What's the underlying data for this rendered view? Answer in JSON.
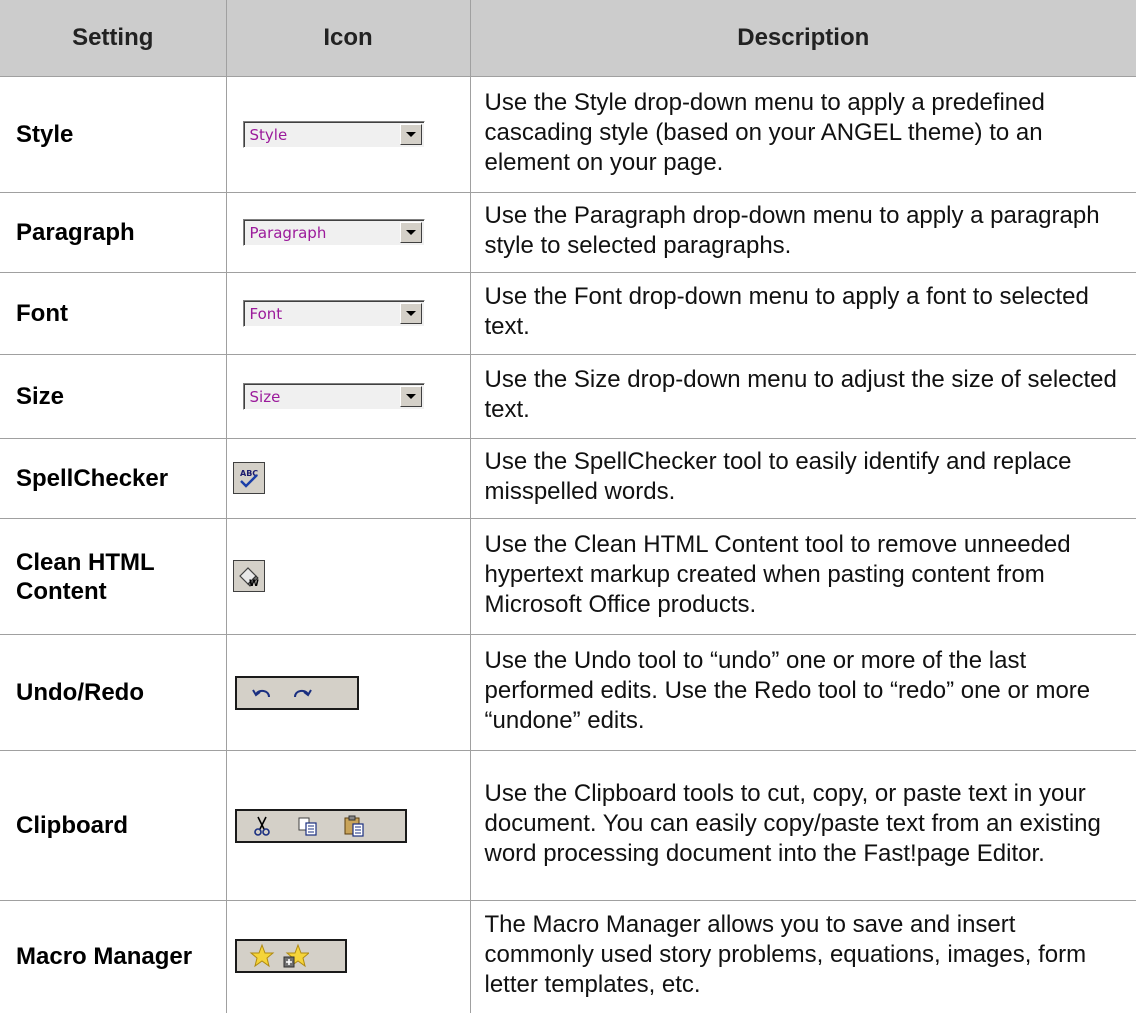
{
  "headers": {
    "setting": "Setting",
    "icon": "Icon",
    "description": "Description"
  },
  "rows": [
    {
      "setting": "Style",
      "dropdown": "Style",
      "description": "Use the Style drop-down menu to apply a predefined cascading style (based on your ANGEL theme) to an element on your page."
    },
    {
      "setting": "Paragraph",
      "dropdown": "Paragraph",
      "description": "Use the Paragraph drop-down menu to apply a paragraph style to selected paragraphs."
    },
    {
      "setting": "Font",
      "dropdown": "Font",
      "description": "Use the Font drop-down menu to apply a font to selected text."
    },
    {
      "setting": "Size",
      "dropdown": "Size",
      "description": "Use the Size drop-down menu to adjust the size of selected text."
    },
    {
      "setting": "SpellChecker",
      "icons": [
        "spellcheck-icon"
      ],
      "description": "Use the SpellChecker tool to easily identify and replace misspelled words."
    },
    {
      "setting": "Clean HTML Content",
      "icons": [
        "eraser-icon"
      ],
      "description": "Use the Clean HTML Content tool to remove unneeded hypertext markup created when pasting content from Microsoft Office products."
    },
    {
      "setting": "Undo/Redo",
      "icons": [
        "undo-icon",
        "redo-icon"
      ],
      "description": "Use the Undo tool to “undo” one or more of the last performed edits. Use the Redo tool to “redo” one or more “undone” edits."
    },
    {
      "setting": "Clipboard",
      "icons": [
        "cut-icon",
        "copy-icon",
        "paste-icon"
      ],
      "description": "Use the Clipboard tools to cut, copy, or paste text in your document. You can easily copy/paste text from an existing word processing document into the Fast!page Editor."
    },
    {
      "setting": "Macro Manager",
      "icons": [
        "star-icon",
        "star-insert-icon"
      ],
      "description": "The Macro Manager allows you to save and insert commonly used story problems, equations, images, form letter templates, etc."
    }
  ],
  "colors": {
    "header_bg": "#cccccc",
    "border": "#a0a0a0",
    "dropdown_text": "#9b1a9b",
    "toolbar_bg": "#d4d0c8"
  }
}
